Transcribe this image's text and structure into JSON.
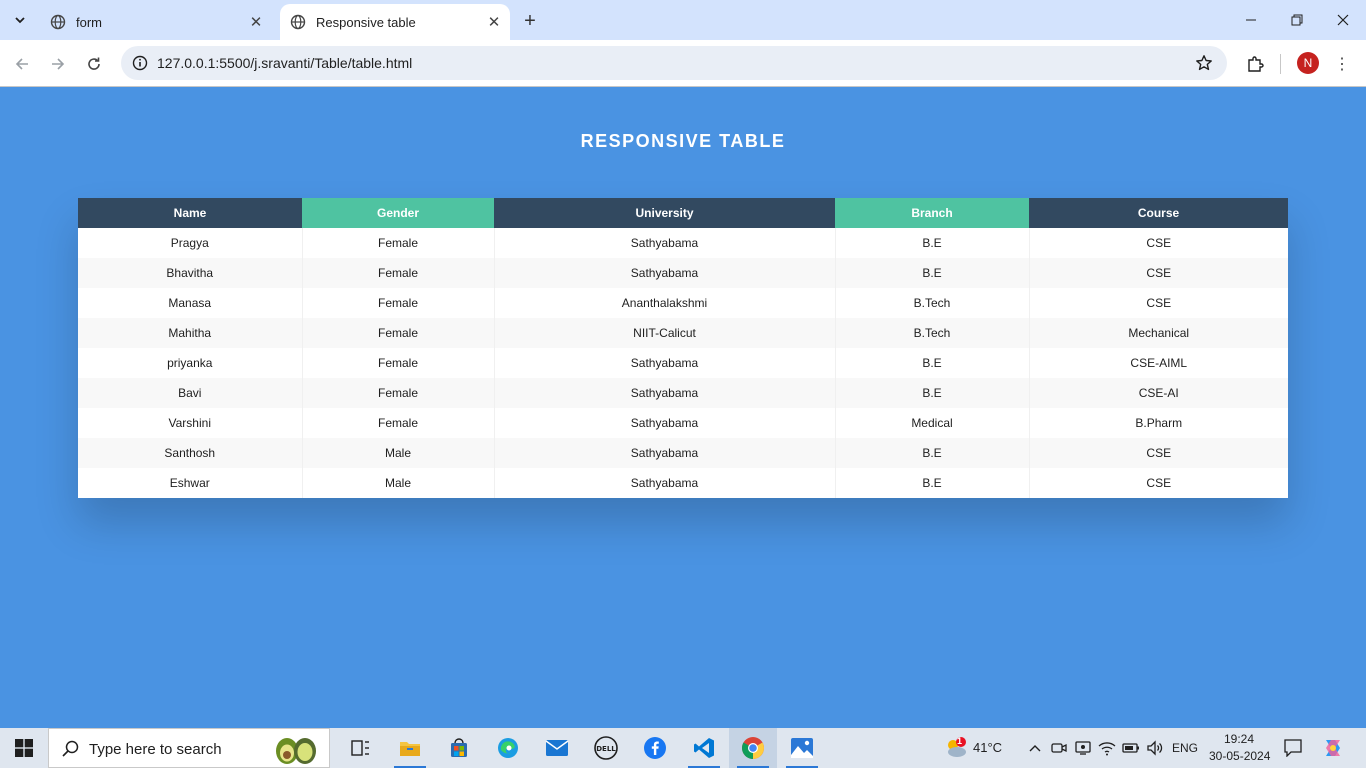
{
  "browser": {
    "tabs": [
      {
        "title": "form",
        "active": false
      },
      {
        "title": "Responsive table",
        "active": true
      }
    ],
    "url": "127.0.0.1:5500/j.sravanti/Table/table.html",
    "profile_initial": "N"
  },
  "page": {
    "title": "RESPONSIVE TABLE",
    "table": {
      "headers": [
        "Name",
        "Gender",
        "University",
        "Branch",
        "Course"
      ],
      "rows": [
        [
          "Pragya",
          "Female",
          "Sathyabama",
          "B.E",
          "CSE"
        ],
        [
          "Bhavitha",
          "Female",
          "Sathyabama",
          "B.E",
          "CSE"
        ],
        [
          "Manasa",
          "Female",
          "Ananthalakshmi",
          "B.Tech",
          "CSE"
        ],
        [
          "Mahitha",
          "Female",
          "NIIT-Calicut",
          "B.Tech",
          "Mechanical"
        ],
        [
          "priyanka",
          "Female",
          "Sathyabama",
          "B.E",
          "CSE-AIML"
        ],
        [
          "Bavi",
          "Female",
          "Sathyabama",
          "B.E",
          "CSE-AI"
        ],
        [
          "Varshini",
          "Female",
          "Sathyabama",
          "Medical",
          "B.Pharm"
        ],
        [
          "Santhosh",
          "Male",
          "Sathyabama",
          "B.E",
          "CSE"
        ],
        [
          "Eshwar",
          "Male",
          "Sathyabama",
          "B.E",
          "CSE"
        ]
      ]
    },
    "colors": {
      "background": "#4a93e2",
      "header_dark": "#324960",
      "header_green": "#4fc3a1"
    }
  },
  "taskbar": {
    "search_placeholder": "Type here to search",
    "weather": "41°C",
    "weather_badge": "1",
    "language": "ENG",
    "time": "19:24",
    "date": "30-05-2024"
  }
}
